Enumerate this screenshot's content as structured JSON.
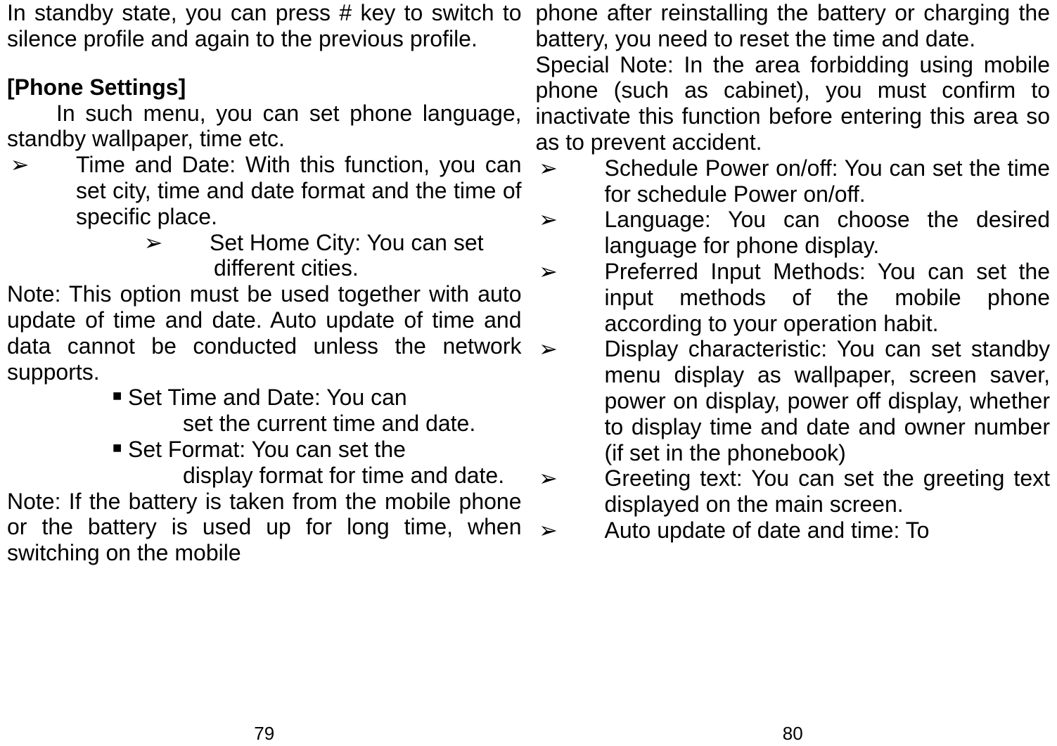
{
  "left": {
    "intro1": "In standby state, you can press # key to switch to silence profile and again to the previous profile.",
    "heading": "[Phone Settings]",
    "intro2": "In such menu, you can set phone language, standby wallpaper, time etc.",
    "bullet_chev": "➢",
    "bullet_sq": "■",
    "li1": "Time and Date: With this function, you can set city, time and date format and the time of specific place.",
    "li1a_a": "Set Home City: You can set",
    "li1a_b": "different cities.",
    "note1": "Note: This option must be used together with auto update of time and date. Auto update of time and data cannot be conducted unless the network supports.",
    "sq1_a": "Set Time and Date: You can",
    "sq1_b": "set the current time and date.",
    "sq2_a": "Set Format: You can set the",
    "sq2_b": "display format for time and date.",
    "note2": "Note: If the battery is taken from the mobile phone or the battery is used up for long time, when switching on the mobile",
    "pagenum": "79"
  },
  "right": {
    "top": "phone after reinstalling the battery or charging the battery, you need to reset the time and date.",
    "special": "Special Note: In the area forbidding using mobile phone (such as cabinet), you must confirm to inactivate this function before entering this area so as to prevent accident.",
    "bullet_chev": "➢",
    "li1": "Schedule Power on/off: You can set the time for schedule Power on/off.",
    "li2": "Language: You can choose the desired language for phone display.",
    "li3": "Preferred Input Methods: You can set the input methods of the mobile phone according to your operation habit.",
    "li4": "Display characteristic: You can set standby menu display as wallpaper, screen saver, power on display, power off display, whether to display time and date and owner number (if set in the phonebook)",
    "li5": "Greeting text: You can set the greeting text displayed on the main screen.",
    "li6": "Auto update of date and time: To",
    "pagenum": "80"
  }
}
